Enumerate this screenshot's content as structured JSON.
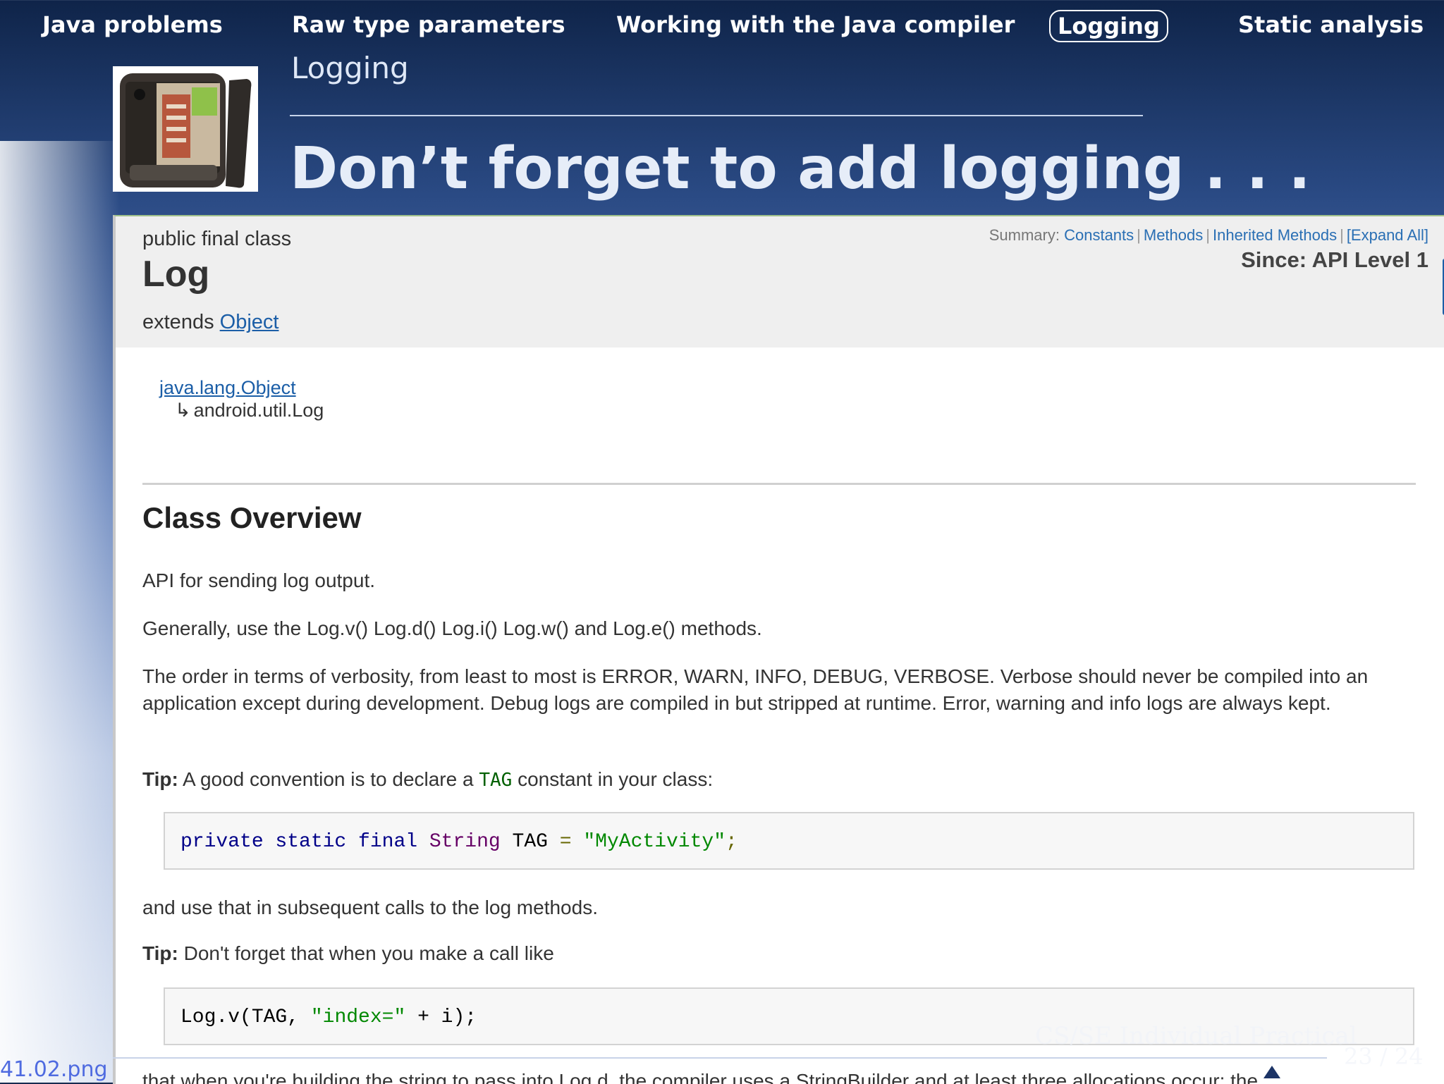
{
  "nav": {
    "items": [
      "Java problems",
      "Raw type parameters",
      "Working with the Java compiler",
      "Logging",
      "Static analysis"
    ],
    "active": "Logging"
  },
  "slide": {
    "frame_title": "Logging",
    "title": "Don’t forget to add logging . . ."
  },
  "doc": {
    "modifiers": "public final class",
    "class_name": "Log",
    "extends_label": "extends",
    "extends_link": "Object",
    "summary_label": "Summary:",
    "summary_links": [
      "Constants",
      "Methods",
      "Inherited Methods",
      "[Expand All]"
    ],
    "since": "Since: API Level 1",
    "hierarchy_parent": "java.lang.Object",
    "hierarchy_arrow": "↳",
    "hierarchy_child": "android.util.Log",
    "overview_heading": "Class Overview",
    "p1": "API for sending log output.",
    "p2": "Generally, use the Log.v() Log.d() Log.i() Log.w() and Log.e() methods.",
    "p3": "The order in terms of verbosity, from least to most is ERROR, WARN, INFO, DEBUG, VERBOSE. Verbose should never be compiled into an application except during development. Debug logs are compiled in but stripped at runtime. Error, warning and info logs are always kept.",
    "tip_label": "Tip:",
    "tip1_pre": "A good convention is to declare a",
    "tip1_code": "TAG",
    "tip1_post": "constant in your class:",
    "code1": {
      "kw": "private static final",
      "type": "String",
      "name": "TAG",
      "op": "=",
      "str": "\"MyActivity\"",
      "end": ";"
    },
    "p_after_code1": "and use that in subsequent calls to the log methods.",
    "tip2": "Don't forget that when you make a call like",
    "code2": {
      "call": "Log.v(TAG,",
      "str": "\"index=\"",
      "rest": "+ i);"
    },
    "p_cut": "that when you're building the string to pass into Log.d, the compiler uses a StringBuilder and at least three allocations occur: the"
  },
  "footer": {
    "title": "CS/SE Individual Practical",
    "page": "23 / 24",
    "file": "41.02.png"
  },
  "colors": {
    "background_top": "#0f2449",
    "background_bottom": "#dde5f3",
    "link": "#1b5ea7",
    "code_string": "#008800",
    "code_keyword": "#000088"
  }
}
